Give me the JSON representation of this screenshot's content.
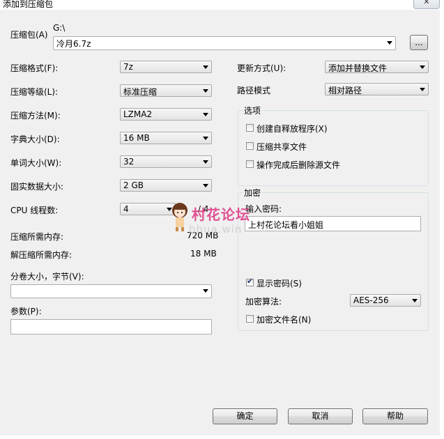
{
  "window": {
    "title": "添加到压缩包",
    "close_glyph": "✕"
  },
  "archive": {
    "label": "压缩包(A)",
    "path": "G:\\",
    "filename": "冷月6.7z",
    "browse_label": "..."
  },
  "left_fields": {
    "format": {
      "label": "压缩格式(F):",
      "value": "7z"
    },
    "level": {
      "label": "压缩等级(L):",
      "value": "标准压缩"
    },
    "method": {
      "label": "压缩方法(M):",
      "value": "LZMA2"
    },
    "dict": {
      "label": "字典大小(D):",
      "value": "16 MB"
    },
    "word": {
      "label": "单词大小(W):",
      "value": "32"
    },
    "solid": {
      "label": "固实数据大小:",
      "value": "2 GB"
    },
    "cpu": {
      "label": "CPU 线程数:",
      "value": "4",
      "total": "/ 4"
    },
    "mem_compress": {
      "label": "压缩所需内存:",
      "value": "720 MB"
    },
    "mem_decompress": {
      "label": "解压缩所需内存:",
      "value": "18 MB"
    },
    "split": {
      "label": "分卷大小，字节(V):",
      "value": ""
    },
    "params": {
      "label": "参数(P):",
      "value": ""
    }
  },
  "right_fields": {
    "update": {
      "label": "更新方式(U):",
      "value": "添加并替换文件"
    },
    "pathmode": {
      "label": "路径模式",
      "value": "相对路径"
    }
  },
  "options": {
    "title": "选项",
    "items": [
      {
        "label": "创建自释放程序(X)",
        "checked": false
      },
      {
        "label": "压缩共享文件",
        "checked": false
      },
      {
        "label": "操作完成后删除源文件",
        "checked": false
      }
    ]
  },
  "encryption": {
    "title": "加密",
    "password_label": "输入密码:",
    "password_value": "上村花论坛看小姐姐",
    "show_password_label": "显示密码(S)",
    "show_password_checked": true,
    "method_label": "加密算法:",
    "method_value": "AES-256",
    "encrypt_names_label": "加密文件名(N)",
    "encrypt_names_checked": false
  },
  "buttons": {
    "ok": "确定",
    "cancel": "取消",
    "help": "帮助"
  },
  "watermark": {
    "text": "村花论坛",
    "sub": "hhua.win"
  },
  "colors": {
    "dialog_bg": "#f0f0f0",
    "watermark": "#e0408a"
  }
}
